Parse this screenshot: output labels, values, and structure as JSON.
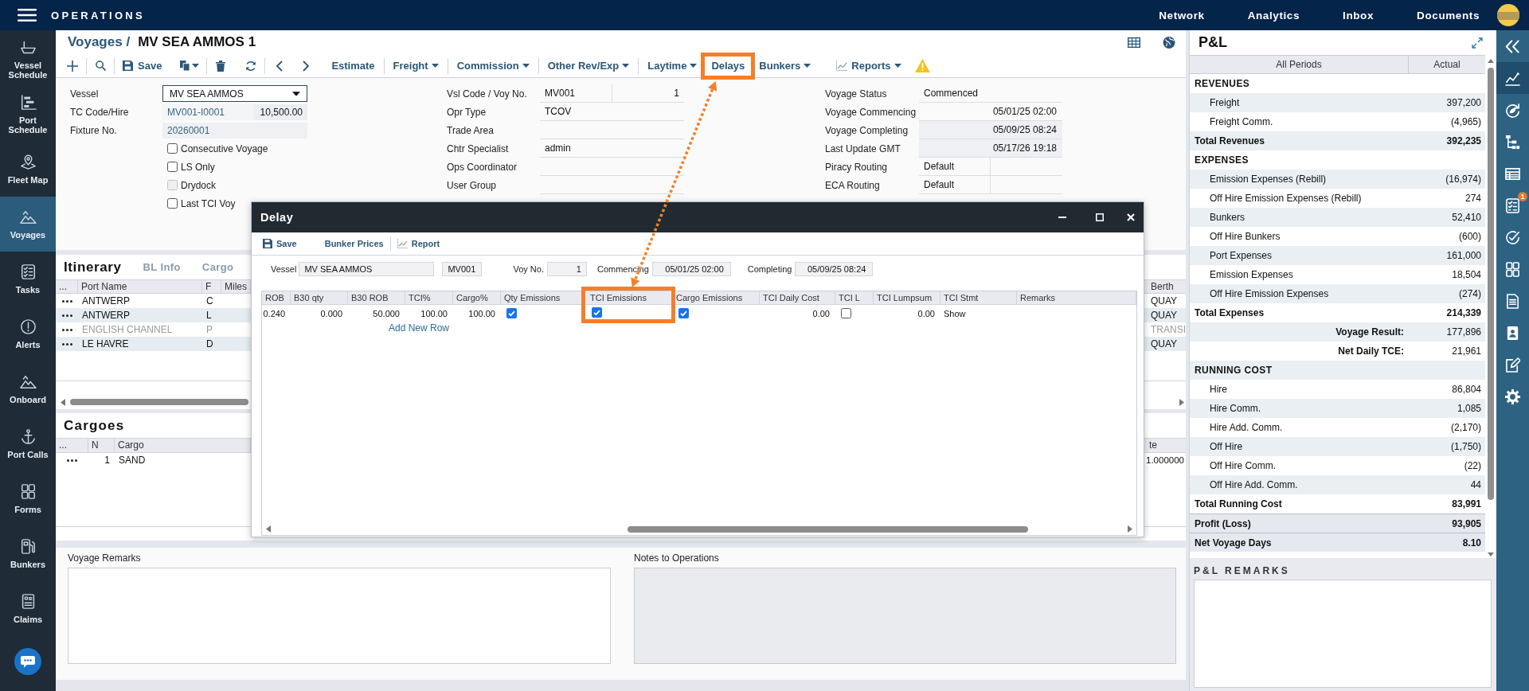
{
  "top_bar": {
    "app_title": "OPERATIONS",
    "nav": [
      "Network",
      "Analytics",
      "Inbox",
      "Documents"
    ]
  },
  "left_nav": [
    {
      "label": "Vessel Schedule",
      "selected": false
    },
    {
      "label": "Port Schedule",
      "selected": false
    },
    {
      "label": "Fleet Map",
      "selected": false
    },
    {
      "label": "Voyages",
      "selected": true
    },
    {
      "label": "Tasks",
      "selected": false
    },
    {
      "label": "Alerts",
      "selected": false
    },
    {
      "label": "Onboard",
      "selected": false
    },
    {
      "label": "Port Calls",
      "selected": false
    },
    {
      "label": "Forms",
      "selected": false
    },
    {
      "label": "Bunkers",
      "selected": false
    },
    {
      "label": "Claims",
      "selected": false
    }
  ],
  "page_header": {
    "breadcrumb": "Voyages /",
    "title": "MV SEA AMMOS 1"
  },
  "toolbar": {
    "save": "Save",
    "menus": [
      {
        "label": "Estimate",
        "dropdown": false,
        "highlighted": false
      },
      {
        "label": "Freight",
        "dropdown": true,
        "highlighted": false
      },
      {
        "label": "Commission",
        "dropdown": true,
        "highlighted": false
      },
      {
        "label": "Other Rev/Exp",
        "dropdown": true,
        "highlighted": false
      },
      {
        "label": "Laytime",
        "dropdown": true,
        "highlighted": false
      },
      {
        "label": "Delays",
        "dropdown": false,
        "highlighted": true
      },
      {
        "label": "Bunkers",
        "dropdown": true,
        "highlighted": false
      }
    ],
    "reports": {
      "label": "Reports",
      "dropdown": true
    },
    "warning": true
  },
  "voyage_form": {
    "column_1": [
      {
        "label": "Vessel",
        "kind": "dropdown",
        "value": "MV SEA AMMOS"
      },
      {
        "label": "TC Code/Hire",
        "kind": "pair",
        "value": "MV001-I0001",
        "value_2": "10,500.00"
      },
      {
        "label": "Fixture No.",
        "kind": "readonly",
        "value": "20260001"
      }
    ],
    "options": [
      {
        "label": "Consecutive Voyage",
        "checked": false,
        "disabled": false
      },
      {
        "label": "LS Only",
        "checked": false,
        "disabled": false
      },
      {
        "label": "Drydock",
        "checked": false,
        "disabled": true
      },
      {
        "label": "Last TCI Voy",
        "checked": false,
        "disabled": false
      }
    ],
    "column_2": [
      {
        "label": "Vsl Code / Voy No.",
        "kind": "pair",
        "value": "MV001",
        "value_2": "1"
      },
      {
        "label": "Opr Type",
        "kind": "text",
        "value": "TCOV"
      },
      {
        "label": "Trade Area",
        "kind": "text"
      },
      {
        "label": "Chtr Specialist",
        "kind": "text",
        "value": "admin"
      },
      {
        "label": "Ops Coordinator",
        "kind": "text"
      },
      {
        "label": "User Group",
        "kind": "text"
      }
    ],
    "column_3": [
      {
        "label": "Voyage Status",
        "kind": "text",
        "value": "Commenced",
        "readonly": false
      },
      {
        "label": "Voyage Commencing",
        "kind": "date",
        "value": "05/01/25 02:00",
        "readonly": false
      },
      {
        "label": "Voyage Completing",
        "kind": "date",
        "value": "05/09/25 08:24",
        "readonly": true
      },
      {
        "label": "Last Update GMT",
        "kind": "date",
        "value": "05/17/26 19:18",
        "readonly": true
      },
      {
        "label": "Piracy Routing",
        "kind": "split",
        "value": "Default",
        "readonly": false
      },
      {
        "label": "ECA Routing",
        "kind": "split",
        "value": "Default",
        "readonly": false
      }
    ]
  },
  "itinerary": {
    "tabs": [
      {
        "label": "Itinerary",
        "selected": true
      },
      {
        "label": "BL Info",
        "selected": false
      },
      {
        "label": "Cargo",
        "selected": false
      }
    ],
    "columns": [
      "...",
      "Port Name",
      "F",
      "Miles",
      "Berth"
    ],
    "rows": [
      {
        "port_name": "ANTWERP",
        "f": "C",
        "berth": "QUAY",
        "disabled": false
      },
      {
        "port_name": "ANTWERP",
        "f": "L",
        "berth": "QUAY",
        "disabled": false
      },
      {
        "port_name": "ENGLISH CHANNEL",
        "f": "P",
        "berth": "TRANSI",
        "disabled": true
      },
      {
        "port_name": "LE HAVRE",
        "f": "D",
        "berth": "QUAY",
        "disabled": false
      }
    ]
  },
  "cargoes": {
    "title": "Cargoes",
    "columns": [
      "...",
      "N",
      "Cargo",
      "te"
    ],
    "rows": [
      {
        "n": "1",
        "cargo": "SAND",
        "column_4": "1.000000"
      }
    ]
  },
  "remarks": [
    {
      "label": "Voyage Remarks",
      "disabled": false
    },
    {
      "label": "Notes to Operations",
      "disabled": true
    }
  ],
  "delay_dialog": {
    "title": "Delay",
    "toolbar": [
      "Save",
      "Bunker Prices",
      "Report"
    ],
    "fields": [
      {
        "label": "Vessel",
        "values": [
          "MV SEA AMMOS",
          "MV001"
        ]
      },
      {
        "label": "Voy No.",
        "values": [
          "1"
        ]
      },
      {
        "label": "Commencing",
        "values": [
          "05/01/25 02:00"
        ]
      },
      {
        "label": "Completing",
        "values": [
          "05/09/25 08:24"
        ]
      }
    ],
    "grid": {
      "columns": [
        {
          "label": "ROB",
          "highlighted": false
        },
        {
          "label": "B30 qty",
          "highlighted": false
        },
        {
          "label": "B30 ROB",
          "highlighted": false
        },
        {
          "label": "TCI%",
          "highlighted": false
        },
        {
          "label": "Cargo%",
          "highlighted": false
        },
        {
          "label": "Qty Emissions",
          "highlighted": false
        },
        {
          "label": "TCI Emissions",
          "highlighted": true
        },
        {
          "label": "Cargo Emissions",
          "highlighted": false
        },
        {
          "label": "TCI Daily Cost",
          "highlighted": false
        },
        {
          "label": "TCI L",
          "highlighted": false
        },
        {
          "label": "TCI Lumpsum",
          "highlighted": false
        },
        {
          "label": "TCI Stmt",
          "highlighted": false
        },
        {
          "label": "Remarks",
          "highlighted": false
        }
      ],
      "rows": [
        {
          "cells": [
            {
              "kind": "number",
              "value": "0.240"
            },
            {
              "kind": "number",
              "value": "0.000"
            },
            {
              "kind": "number",
              "value": "50.000"
            },
            {
              "kind": "number",
              "value": "100.00"
            },
            {
              "kind": "number",
              "value": "100.00"
            },
            {
              "kind": "checkbox",
              "checked": true
            },
            {
              "kind": "checkbox",
              "checked": true
            },
            {
              "kind": "checkbox",
              "checked": true
            },
            {
              "kind": "number",
              "value": "0.00"
            },
            {
              "kind": "checkbox",
              "checked": false
            },
            {
              "kind": "number",
              "value": "0.00"
            },
            {
              "kind": "text",
              "value": "Show"
            }
          ]
        }
      ],
      "add_row": "Add New Row"
    }
  },
  "callout_arrow": true,
  "pnl": {
    "title": "P&L",
    "columns": [
      "All Periods",
      "Actual"
    ],
    "rows": [
      {
        "kind": "section",
        "label": "REVENUES"
      },
      {
        "kind": "item",
        "label": "Freight",
        "value": "397,200"
      },
      {
        "kind": "item",
        "label": "Freight Comm.",
        "value": "(4,965)"
      },
      {
        "kind": "total",
        "label": "Total Revenues",
        "value": "392,235"
      },
      {
        "kind": "section",
        "label": "EXPENSES"
      },
      {
        "kind": "item",
        "label": "Emission Expenses (Rebill)",
        "value": "(16,974)"
      },
      {
        "kind": "item",
        "label": "Off Hire Emission Expenses (Rebill)",
        "value": "274"
      },
      {
        "kind": "item",
        "label": "Bunkers",
        "value": "52,410"
      },
      {
        "kind": "item",
        "label": "Off Hire Bunkers",
        "value": "(600)"
      },
      {
        "kind": "item",
        "label": "Port Expenses",
        "value": "161,000"
      },
      {
        "kind": "item",
        "label": "Emission Expenses",
        "value": "18,504"
      },
      {
        "kind": "item",
        "label": "Off Hire Emission Expenses",
        "value": "(274)"
      },
      {
        "kind": "total",
        "label": "Total Expenses",
        "value": "214,339"
      },
      {
        "kind": "result",
        "label": "Voyage Result:",
        "value": "177,896"
      },
      {
        "kind": "result",
        "label": "Net Daily TCE:",
        "value": "21,961"
      },
      {
        "kind": "section",
        "label": "RUNNING COST"
      },
      {
        "kind": "item",
        "label": "Hire",
        "value": "86,804"
      },
      {
        "kind": "item",
        "label": "Hire Comm.",
        "value": "1,085"
      },
      {
        "kind": "item",
        "label": "Hire Add. Comm.",
        "value": "(2,170)"
      },
      {
        "kind": "item",
        "label": "Off Hire",
        "value": "(1,750)"
      },
      {
        "kind": "item",
        "label": "Off Hire Comm.",
        "value": "(22)"
      },
      {
        "kind": "item",
        "label": "Off Hire Add. Comm.",
        "value": "44"
      },
      {
        "kind": "total",
        "label": "Total Running Cost",
        "value": "83,991"
      },
      {
        "kind": "summary",
        "label": "Profit (Loss)",
        "value": "93,905"
      },
      {
        "kind": "summary",
        "label": "Net Voyage Days",
        "value": "8.10"
      }
    ],
    "remarks_label": "P&L REMARKS"
  },
  "right_bar": [
    {
      "selected": true
    },
    {
      "selected": false
    },
    {
      "selected": false
    },
    {
      "selected": false
    },
    {
      "selected": false,
      "badge": "1"
    },
    {
      "selected": false
    },
    {
      "selected": false
    },
    {
      "selected": false
    },
    {
      "selected": false
    },
    {
      "selected": false
    },
    {
      "selected": false
    }
  ]
}
